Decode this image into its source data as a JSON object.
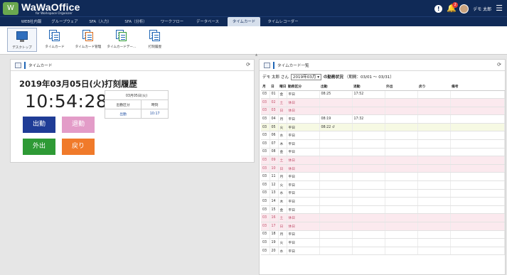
{
  "header": {
    "logo_text": "WaWaOffice",
    "logo_sub": "for Workspace Organizer",
    "logo_mark": "W",
    "info_glyph": "!",
    "notification_count": "2",
    "user_name": "デモ 太郎",
    "menu_glyph": "☰"
  },
  "tabs": [
    {
      "label": "WEB社内報"
    },
    {
      "label": "グループウェア"
    },
    {
      "label": "SFA（入力）"
    },
    {
      "label": "SFA（分析）"
    },
    {
      "label": "ワークフロー"
    },
    {
      "label": "データベース"
    },
    {
      "label": "タイムカード"
    },
    {
      "label": "タイムレコーダー"
    }
  ],
  "toolbar": [
    {
      "label": "デスクトップ",
      "icon": "desktop-icon"
    },
    {
      "label": "タイムカード",
      "icon": "timecard-icon"
    },
    {
      "label": "タイムカード管理",
      "icon": "timecard-admin-icon"
    },
    {
      "label": "タイムカードデー…",
      "icon": "timecard-data-icon"
    },
    {
      "label": "打刻履歴",
      "icon": "stamp-history-icon"
    }
  ],
  "left_panel": {
    "title": "タイムカード",
    "date": "2019年03月05日(火)",
    "stamp_title": "打刻履歴",
    "clock": "10:54:28",
    "history": {
      "date_header": "03月05日(火)",
      "col_type": "出勤区分",
      "col_time": "時刻",
      "rows": [
        {
          "type": "出勤",
          "time": "10:17"
        }
      ]
    },
    "buttons": {
      "in": "出勤",
      "out": "退勤",
      "go_out": "外出",
      "back": "戻り"
    }
  },
  "right_panel": {
    "title": "タイムカード一覧",
    "user_prefix": "デモ 太郎 さん",
    "month": "2019年03月",
    "status_label": "の勤務状況",
    "period": "（期間：03/01 〜 03/31）",
    "columns": [
      "月",
      "日",
      "曜日",
      "勤務区分",
      "出勤",
      "退勤",
      "外出",
      "戻り",
      "備考"
    ],
    "rows": [
      {
        "m": "03",
        "d": "01",
        "dow": "金",
        "kind": "平日",
        "in": "08:25",
        "out": "17:52",
        "weekend": false
      },
      {
        "m": "03",
        "d": "02",
        "dow": "土",
        "kind": "休日",
        "in": "",
        "out": "",
        "weekend": true
      },
      {
        "m": "03",
        "d": "03",
        "dow": "日",
        "kind": "休日",
        "in": "",
        "out": "",
        "weekend": true
      },
      {
        "m": "03",
        "d": "04",
        "dow": "月",
        "kind": "平日",
        "in": "08:19",
        "out": "17:32",
        "weekend": false
      },
      {
        "m": "03",
        "d": "05",
        "dow": "火",
        "kind": "平日",
        "in": "08:22",
        "out": "",
        "weekend": false,
        "today": true
      },
      {
        "m": "03",
        "d": "06",
        "dow": "水",
        "kind": "平日",
        "in": "",
        "out": "",
        "weekend": false
      },
      {
        "m": "03",
        "d": "07",
        "dow": "木",
        "kind": "平日",
        "in": "",
        "out": "",
        "weekend": false
      },
      {
        "m": "03",
        "d": "08",
        "dow": "金",
        "kind": "平日",
        "in": "",
        "out": "",
        "weekend": false
      },
      {
        "m": "03",
        "d": "09",
        "dow": "土",
        "kind": "休日",
        "in": "",
        "out": "",
        "weekend": true
      },
      {
        "m": "03",
        "d": "10",
        "dow": "日",
        "kind": "休日",
        "in": "",
        "out": "",
        "weekend": true
      },
      {
        "m": "03",
        "d": "11",
        "dow": "月",
        "kind": "平日",
        "in": "",
        "out": "",
        "weekend": false
      },
      {
        "m": "03",
        "d": "12",
        "dow": "火",
        "kind": "平日",
        "in": "",
        "out": "",
        "weekend": false
      },
      {
        "m": "03",
        "d": "13",
        "dow": "水",
        "kind": "平日",
        "in": "",
        "out": "",
        "weekend": false
      },
      {
        "m": "03",
        "d": "14",
        "dow": "木",
        "kind": "平日",
        "in": "",
        "out": "",
        "weekend": false
      },
      {
        "m": "03",
        "d": "15",
        "dow": "金",
        "kind": "平日",
        "in": "",
        "out": "",
        "weekend": false
      },
      {
        "m": "03",
        "d": "16",
        "dow": "土",
        "kind": "休日",
        "in": "",
        "out": "",
        "weekend": true
      },
      {
        "m": "03",
        "d": "17",
        "dow": "日",
        "kind": "休日",
        "in": "",
        "out": "",
        "weekend": true
      },
      {
        "m": "03",
        "d": "18",
        "dow": "月",
        "kind": "平日",
        "in": "",
        "out": "",
        "weekend": false
      },
      {
        "m": "03",
        "d": "19",
        "dow": "火",
        "kind": "平日",
        "in": "",
        "out": "",
        "weekend": false
      },
      {
        "m": "03",
        "d": "20",
        "dow": "水",
        "kind": "平日",
        "in": "",
        "out": "",
        "weekend": false
      }
    ]
  },
  "colors": {
    "header_bg": "#102a57",
    "weekend_bg": "#fbe9ee",
    "today_bg": "#f6f9e3",
    "btn_in": "#1f3c96",
    "btn_out": "#e39cc8",
    "btn_go": "#2e9a35",
    "btn_back": "#f07a2a"
  }
}
